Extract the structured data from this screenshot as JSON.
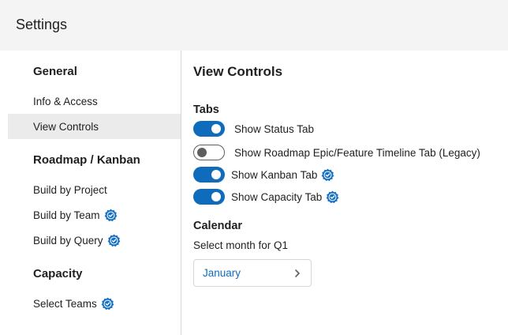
{
  "header": {
    "title": "Settings"
  },
  "sidebar": {
    "sections": [
      {
        "heading": "General",
        "items": [
          "Info & Access",
          "View Controls"
        ]
      },
      {
        "heading": "Roadmap / Kanban",
        "items": [
          "Build by Project",
          "Build by Team",
          "Build by Query"
        ]
      },
      {
        "heading": "Capacity",
        "items": [
          "Select Teams"
        ]
      }
    ],
    "selected_item": "View Controls",
    "verified_items": [
      "Build by Team",
      "Build by Query",
      "Select Teams"
    ]
  },
  "main": {
    "title": "View Controls",
    "tabs_section": {
      "heading": "Tabs",
      "toggles": [
        {
          "label": "Show Status Tab",
          "on": true,
          "verified": false
        },
        {
          "label": "Show Roadmap Epic/Feature Timeline Tab (Legacy)",
          "on": false,
          "verified": false
        },
        {
          "label": "Show Kanban Tab",
          "on": true,
          "verified": true
        },
        {
          "label": "Show Capacity Tab",
          "on": true,
          "verified": true
        }
      ]
    },
    "calendar_section": {
      "heading": "Calendar",
      "field_label": "Select month for Q1",
      "selected_month": "January"
    }
  },
  "colors": {
    "accent": "#0f6cbd",
    "header_bg": "#f4f4f4",
    "selected_bg": "#ebebeb",
    "badge": "#1671c5"
  },
  "icons": {
    "verified": "verified-badge-icon",
    "dropdown": "chevron-right-icon"
  }
}
